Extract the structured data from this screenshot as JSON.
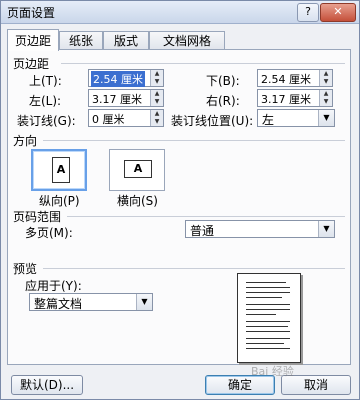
{
  "window": {
    "title": "页面设置",
    "help_label": "?",
    "close_label": "✕"
  },
  "tabs": [
    "页边距",
    "纸张",
    "版式",
    "文档网格"
  ],
  "margins": {
    "section_label": "页边距",
    "top": {
      "label": "上(T):",
      "value": "2.54 厘米"
    },
    "bottom": {
      "label": "下(B):",
      "value": "2.54 厘米"
    },
    "left": {
      "label": "左(L):",
      "value": "3.17 厘米"
    },
    "right": {
      "label": "右(R):",
      "value": "3.17 厘米"
    },
    "gutter": {
      "label": "装订线(G):",
      "value": "0 厘米"
    },
    "gutter_pos": {
      "label": "装订线位置(U):",
      "value": "左"
    }
  },
  "orientation": {
    "section_label": "方向",
    "portrait_label": "纵向(P)",
    "landscape_label": "横向(S)",
    "icon_letter": "A",
    "selected": "portrait"
  },
  "pages": {
    "section_label": "页码范围",
    "multiple_label": "多页(M):",
    "multiple_value": "普通"
  },
  "preview": {
    "section_label": "预览",
    "apply_label": "应用于(Y):",
    "apply_value": "整篇文档"
  },
  "footer": {
    "default_label": "默认(D)...",
    "ok_label": "确定",
    "cancel_label": "取消"
  },
  "watermark": "Bai 经验",
  "colors": {
    "accent": "#3b6fd0",
    "close": "#c4503a"
  }
}
